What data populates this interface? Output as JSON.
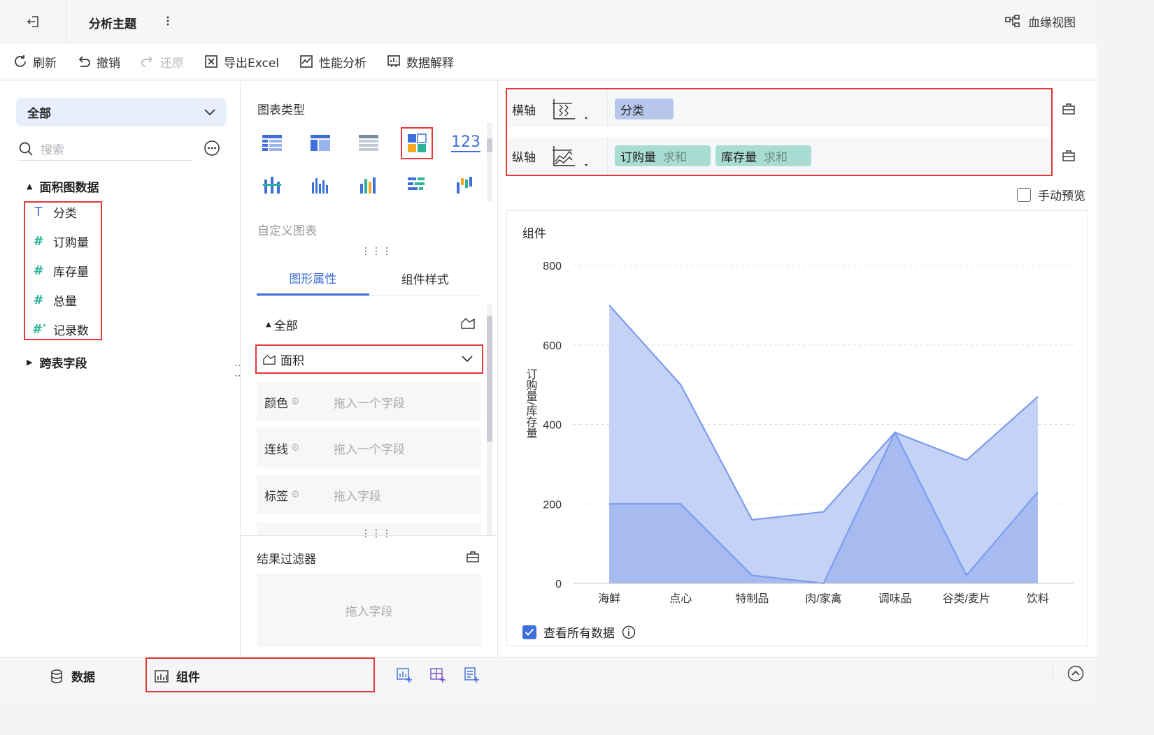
{
  "topbar": {
    "title": "分析主题",
    "lineage_label": "血缘视图"
  },
  "toolbar": {
    "refresh": "刷新",
    "undo": "撤销",
    "redo": "还原",
    "export": "导出Excel",
    "perf": "性能分析",
    "explain": "数据解释"
  },
  "left": {
    "scope": "全部",
    "search_placeholder": "搜索",
    "folder1": "面积图数据",
    "fields": [
      "分类",
      "订购量",
      "库存量",
      "总量",
      "记录数"
    ],
    "folder2": "跨表字段"
  },
  "mid": {
    "chart_type_title": "图表类型",
    "number_icon": "123",
    "custom_chart": "自定义图表",
    "tab_props": "图形属性",
    "tab_style": "组件样式",
    "all": "全部",
    "area": "面积",
    "rows": [
      {
        "label": "颜色",
        "placeholder": "拖入一个字段"
      },
      {
        "label": "连线",
        "placeholder": "拖入一个字段"
      },
      {
        "label": "标签",
        "placeholder": "拖入字段"
      }
    ],
    "filter_title": "结果过滤器",
    "filter_placeholder": "拖入字段"
  },
  "right": {
    "x_axis_label": "横轴",
    "y_axis_label": "纵轴",
    "x_pill": "分类",
    "y_pills": [
      {
        "name": "订购量",
        "agg": "求和"
      },
      {
        "name": "库存量",
        "agg": "求和"
      }
    ],
    "manual_preview": "手动预览",
    "chart_title": "组件",
    "view_all": "查看所有数据"
  },
  "chart_data": {
    "type": "area",
    "title": "组件",
    "ylabel": "订购量/库存量",
    "categories": [
      "海鲜",
      "点心",
      "特制品",
      "肉/家禽",
      "调味品",
      "谷类/麦片",
      "饮料"
    ],
    "ylim": [
      0,
      800
    ],
    "yticks": [
      0,
      200,
      400,
      600,
      800
    ],
    "series": [
      {
        "name": "订购量",
        "values": [
          700,
          500,
          160,
          180,
          380,
          310,
          470
        ],
        "color": "#c4d2f5"
      },
      {
        "name": "库存量",
        "values": [
          200,
          200,
          20,
          0,
          380,
          20,
          230
        ],
        "color": "#a2b7ef"
      }
    ],
    "line_color": "#7c9cec"
  },
  "bottom": {
    "data_tab": "数据",
    "component_tab": "组件"
  },
  "colors": {
    "accent": "#3f6fd9",
    "highlight": "#e5383b",
    "measure": "#2db39a"
  }
}
